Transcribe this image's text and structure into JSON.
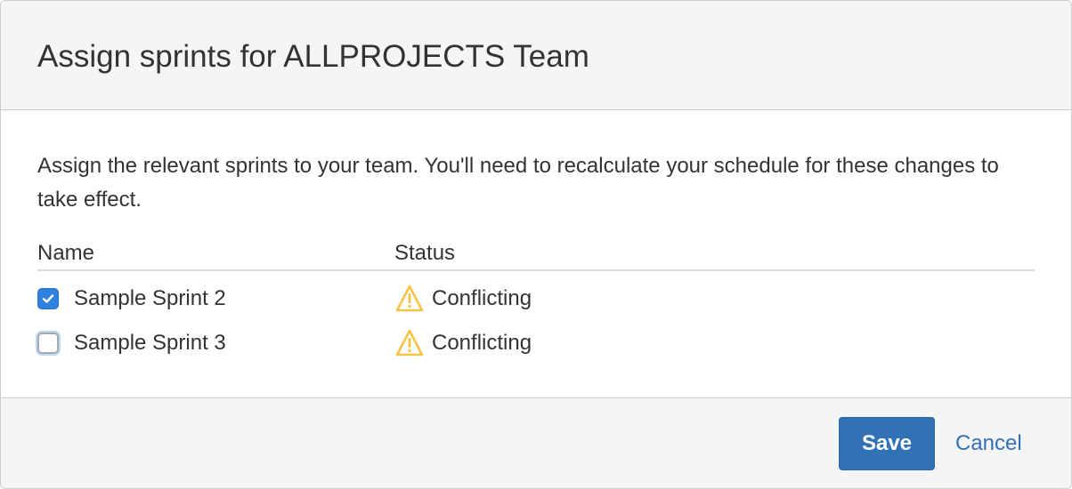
{
  "dialog": {
    "title": "Assign sprints for ALLPROJECTS Team",
    "description": "Assign the relevant sprints to your team. You'll need to recalculate your schedule for these changes to take effect."
  },
  "table": {
    "headers": {
      "name": "Name",
      "status": "Status"
    },
    "rows": [
      {
        "name": "Sample Sprint 2",
        "status": "Conflicting",
        "checked": true,
        "status_icon": "warning-icon"
      },
      {
        "name": "Sample Sprint 3",
        "status": "Conflicting",
        "checked": false,
        "status_icon": "warning-icon"
      }
    ]
  },
  "footer": {
    "save_label": "Save",
    "cancel_label": "Cancel"
  },
  "colors": {
    "primary": "#3172b6",
    "checkbox_checked": "#2f81e0",
    "warning": "#f6c342",
    "header_bg": "#f5f5f5"
  }
}
